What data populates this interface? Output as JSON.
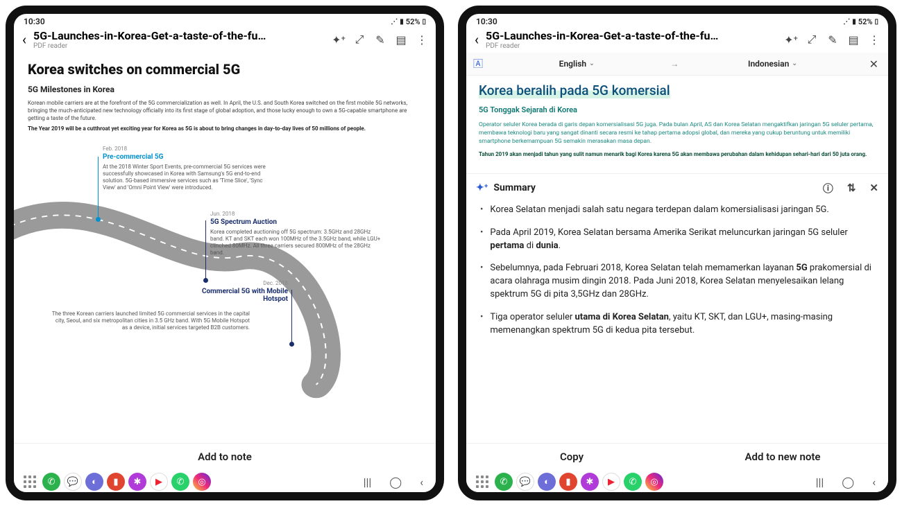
{
  "status": {
    "time": "10:30",
    "battery": "52%"
  },
  "header": {
    "title": "5G-Launches-in-Korea-Get-a-taste-of-the-fu…",
    "subtitle": "PDF reader"
  },
  "doc": {
    "h1": "Korea switches on commercial 5G",
    "h2": "5G Milestones in Korea",
    "p1": "Korean mobile carriers are at the forefront of the 5G commercialization as well. In April, the U.S. and South Korea switched on the first mobile 5G networks, bringing the much-anticipated new technology officially into its first stage of global adoption, and those lucky enough to own a 5G-capable smartphone are getting a taste of the future.",
    "p2": "The Year 2019 will be a cutthroat yet exciting year for Korea as 5G is about to bring changes in day-to-day lives of 50 millions of people.",
    "milestones": [
      {
        "date": "Feb. 2018",
        "title": "Pre-commercial 5G",
        "body": "At the 2018 Winter Sport Events, pre-commercial 5G services were successfully showcased in Korea with Samsung's 5G end-to-end solution. 5G-based immersive services such as 'Time Slice', 'Sync View' and 'Omni Point View' were introduced."
      },
      {
        "date": "Jun. 2018",
        "title": "5G Spectrum Auction",
        "body": "Korea completed auctioning off 5G spectrum: 3.5GHz and 28GHz band. KT and SKT each won 100MHz of the 3.5GHz band, while LGU+ clinched 80MHz. All three carriers secured 800MHz of the 28GHz band."
      },
      {
        "date": "Dec. 2018",
        "title": "Commercial 5G with Mobile Hotspot",
        "body": "The three Korean carriers launched limited 5G commercial services in the capital city, Seoul, and six metropolitan cities in 3.5 GHz band. With 5G Mobile Hotspot as a device, initial services targeted B2B customers."
      }
    ]
  },
  "bottom": {
    "addnote": "Add to note",
    "copy": "Copy",
    "addnew": "Add to new note"
  },
  "translate": {
    "src": "English",
    "dst": "Indonesian"
  },
  "tdoc": {
    "h1": "Korea beralih pada 5G komersial",
    "h2": "5G Tonggak Sejarah di Korea",
    "p1": "Operator seluler Korea berada di garis depan komersialisasi 5G juga. Pada bulan April, AS dan Korea Selatan mengaktifkan jaringan 5G seluler pertama, membawa teknologi baru yang sangat dinanti secara resmi ke tahap pertama adopsi global, dan mereka yang cukup beruntung untuk memiliki smartphone berkemampuan 5G semakin merasakan masa depan.",
    "p2": "Tahun 2019 akan menjadi tahun yang sulit namun menarik bagi Korea karena 5G akan membawa perubahan dalam kehidupan sehari-hari dari 50 juta orang."
  },
  "summary": {
    "title": "Summary",
    "items": [
      "Korea Selatan menjadi salah satu negara terdepan dalam komersialisasi jaringan 5G.",
      "Pada April 2019, Korea Selatan bersama Amerika Serikat meluncurkan jaringan 5G seluler <b>pertama</b> di <b>dunia</b>.",
      "Sebelumnya, pada Februari 2018, Korea Selatan telah memamerkan layanan <b>5G</b> prakomersial di acara olahraga musim dingin 2018. Pada Juni 2018, Korea Selatan menyelesaikan lelang spektrum 5G di pita 3,5GHz dan 28GHz.",
      "Tiga operator seluler <b>utama di Korea Selatan</b>, yaitu KT, SKT, dan LGU+, masing-masing memenangkan spektrum 5G di kedua pita tersebut."
    ]
  },
  "apps": [
    {
      "name": "apps-grid",
      "bg": "transparent",
      "glyph": ""
    },
    {
      "name": "phone",
      "bg": "#2bb24c",
      "glyph": "✆"
    },
    {
      "name": "messages",
      "bg": "#ffffff",
      "glyph": "💬"
    },
    {
      "name": "browser",
      "bg": "#6e6ed8",
      "glyph": "◐"
    },
    {
      "name": "notes",
      "bg": "#e0452f",
      "glyph": "▮"
    },
    {
      "name": "gallery",
      "bg": "#b03bd8",
      "glyph": "✱"
    },
    {
      "name": "youtube",
      "bg": "#ffffff",
      "glyph": "▶"
    },
    {
      "name": "whatsapp",
      "bg": "#28d16a",
      "glyph": "✆"
    },
    {
      "name": "instagram",
      "bg": "linear-gradient(45deg,#f9ce34,#ee2a7b,#6228d7)",
      "glyph": "◎"
    }
  ]
}
